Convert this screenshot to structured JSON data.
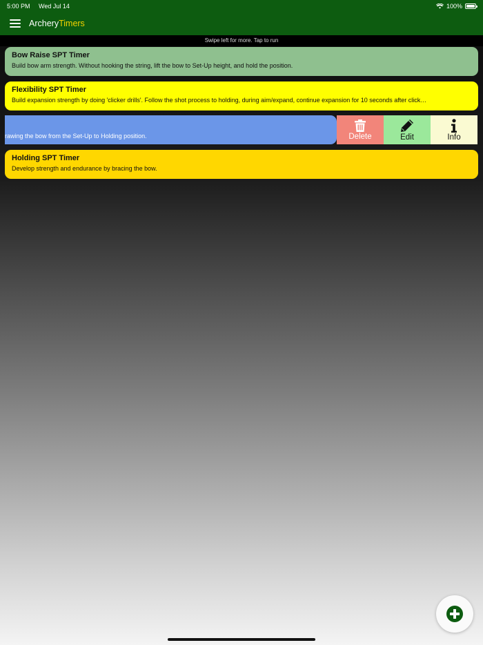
{
  "status_bar": {
    "time": "5:00 PM",
    "date": "Wed Jul 14",
    "battery": "100%",
    "battery_level": 1.0
  },
  "nav": {
    "title_part1": "Archery",
    "title_part2": "Timers",
    "menu_icon": "hamburger-menu-icon"
  },
  "hint": "Swipe left for more. Tap to run",
  "colors": {
    "header_green": "#0d5c10",
    "title_accent": "#f3d200"
  },
  "timers": [
    {
      "name": "Bow Raise SPT Timer",
      "description": "Build bow arm strength. Without hooking the string, lift the bow to Set-Up height, and hold the position.",
      "color": "#8fc08f"
    },
    {
      "name": "Flexibility SPT Timer",
      "description": "Build expansion strength by doing 'clicker drills'. Follow the shot process to holding, during aim/expand, continue expansion for 10 seconds after click…",
      "color": "#ffff00"
    },
    {
      "name": "",
      "description": "rawing the bow from the Set-Up to Holding position.",
      "color": "#6b96e8"
    },
    {
      "name": "Holding SPT Timer",
      "description": "Develop strength and endurance by bracing the bow.",
      "color": "#ffd700"
    }
  ],
  "swipe_actions": {
    "delete_label": "Delete",
    "delete_icon": "trash-icon",
    "edit_label": "Edit",
    "edit_icon": "pencil-icon",
    "info_label": "Info",
    "info_icon": "info-icon"
  },
  "fab_icon": "plus-circle-icon"
}
